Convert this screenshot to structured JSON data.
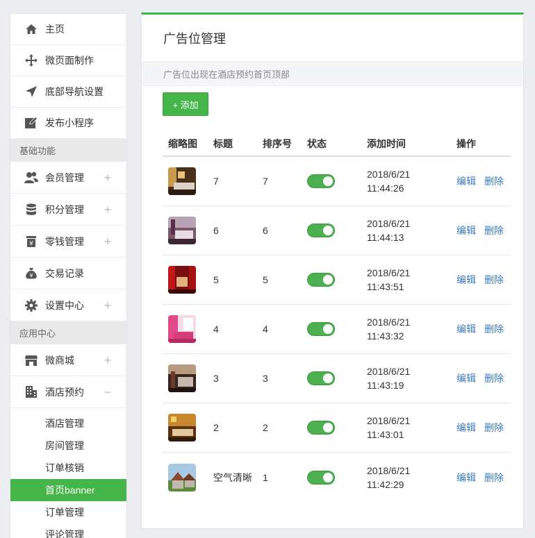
{
  "sidebar": {
    "items_top": [
      {
        "label": "主页",
        "icon": "home-icon"
      },
      {
        "label": "微页面制作",
        "icon": "move-icon"
      },
      {
        "label": "底部导航设置",
        "icon": "navigation-arrow-icon"
      },
      {
        "label": "发布小程序",
        "icon": "edit-icon"
      }
    ],
    "section_basic": "基础功能",
    "items_basic": [
      {
        "label": "会员管理",
        "icon": "users-icon",
        "toggle": "+"
      },
      {
        "label": "积分管理",
        "icon": "database-icon",
        "toggle": "+"
      },
      {
        "label": "零钱管理",
        "icon": "wallet-icon",
        "toggle": "+"
      },
      {
        "label": "交易记录",
        "icon": "money-bag-icon"
      },
      {
        "label": "设置中心",
        "icon": "gear-icon",
        "toggle": "+"
      }
    ],
    "section_apps": "应用中心",
    "items_apps": [
      {
        "label": "微商城",
        "icon": "store-icon",
        "toggle": "+"
      },
      {
        "label": "酒店预约",
        "icon": "building-icon",
        "toggle": "−"
      }
    ],
    "sub_items": [
      "酒店管理",
      "房间管理",
      "订单核销",
      "首页banner",
      "订单管理",
      "评论管理"
    ]
  },
  "main": {
    "title": "广告位管理",
    "notice": "广告位出现在酒店预约首页顶部",
    "add_label": "+ 添加",
    "columns": [
      "缩略图",
      "标题",
      "排序号",
      "状态",
      "添加时间",
      "操作"
    ],
    "edit_label": "编辑",
    "delete_label": "删除",
    "rows": [
      {
        "title": "7",
        "order": "7",
        "date": "2018/6/21",
        "time": "11:44:26"
      },
      {
        "title": "6",
        "order": "6",
        "date": "2018/6/21",
        "time": "11:44:13"
      },
      {
        "title": "5",
        "order": "5",
        "date": "2018/6/21",
        "time": "11:43:51"
      },
      {
        "title": "4",
        "order": "4",
        "date": "2018/6/21",
        "time": "11:43:32"
      },
      {
        "title": "3",
        "order": "3",
        "date": "2018/6/21",
        "time": "11:43:19"
      },
      {
        "title": "2",
        "order": "2",
        "date": "2018/6/21",
        "time": "11:43:01"
      },
      {
        "title": "空气清晰",
        "order": "1",
        "date": "2018/6/21",
        "time": "11:42:29"
      }
    ]
  },
  "colors": {
    "accent": "#44b549",
    "link": "#3b7ab8"
  }
}
